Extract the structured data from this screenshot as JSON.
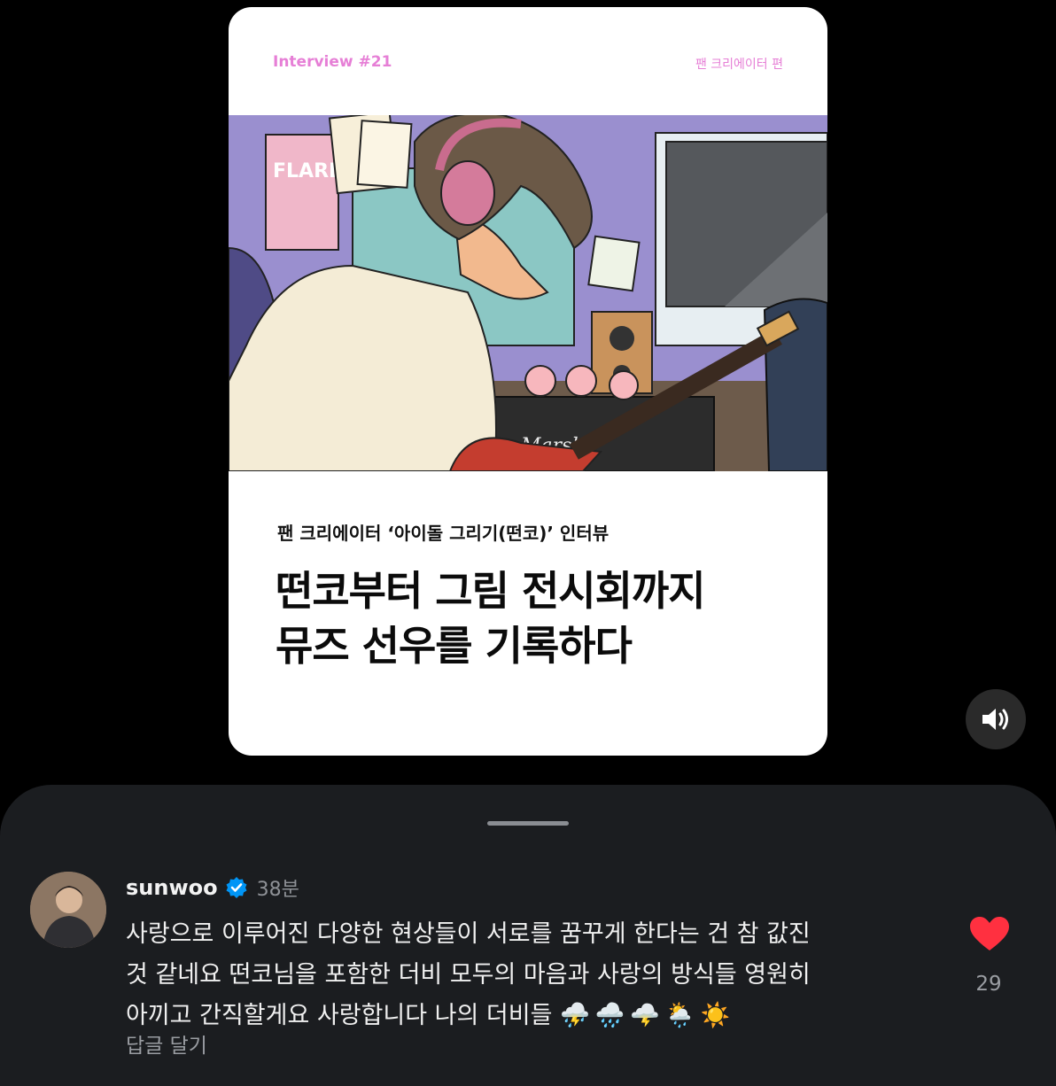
{
  "card": {
    "interview_label": "Interview #21",
    "edition_label": "팬 크리에이터 편",
    "subtitle": "팬 크리에이터 ‘아이돌 그리기(떤코)’ 인터뷰",
    "headline_line1": "떤코부터 그림 전시회까지",
    "headline_line2": "뮤즈 선우를 기록하다"
  },
  "comment": {
    "username": "sunwoo",
    "time": "38분",
    "line1": "사랑으로 이루어진 다양한 현상들이 서로를 꿈꾸게 한다는 건 참 값진",
    "line2": "것 같네요 떤코님을 포함한 더비 모두의 마음과 사랑의 방식들 영원히",
    "line3": "아끼고 간직할게요 사랑합니다 나의 더비들",
    "emojis": [
      "⛈️",
      "🌧️",
      "🌩️",
      "🌦️",
      "☀️"
    ],
    "reply_label": "답글 달기",
    "like_count": "29"
  },
  "icons": {
    "sound": "speaker-icon",
    "like": "heart-icon",
    "verified": "verified-badge-icon"
  },
  "colors": {
    "accent_pink": "#e67fd6",
    "like_red": "#ff3040",
    "verified_blue": "#0095f6",
    "sheet_bg": "#1b1d20"
  }
}
